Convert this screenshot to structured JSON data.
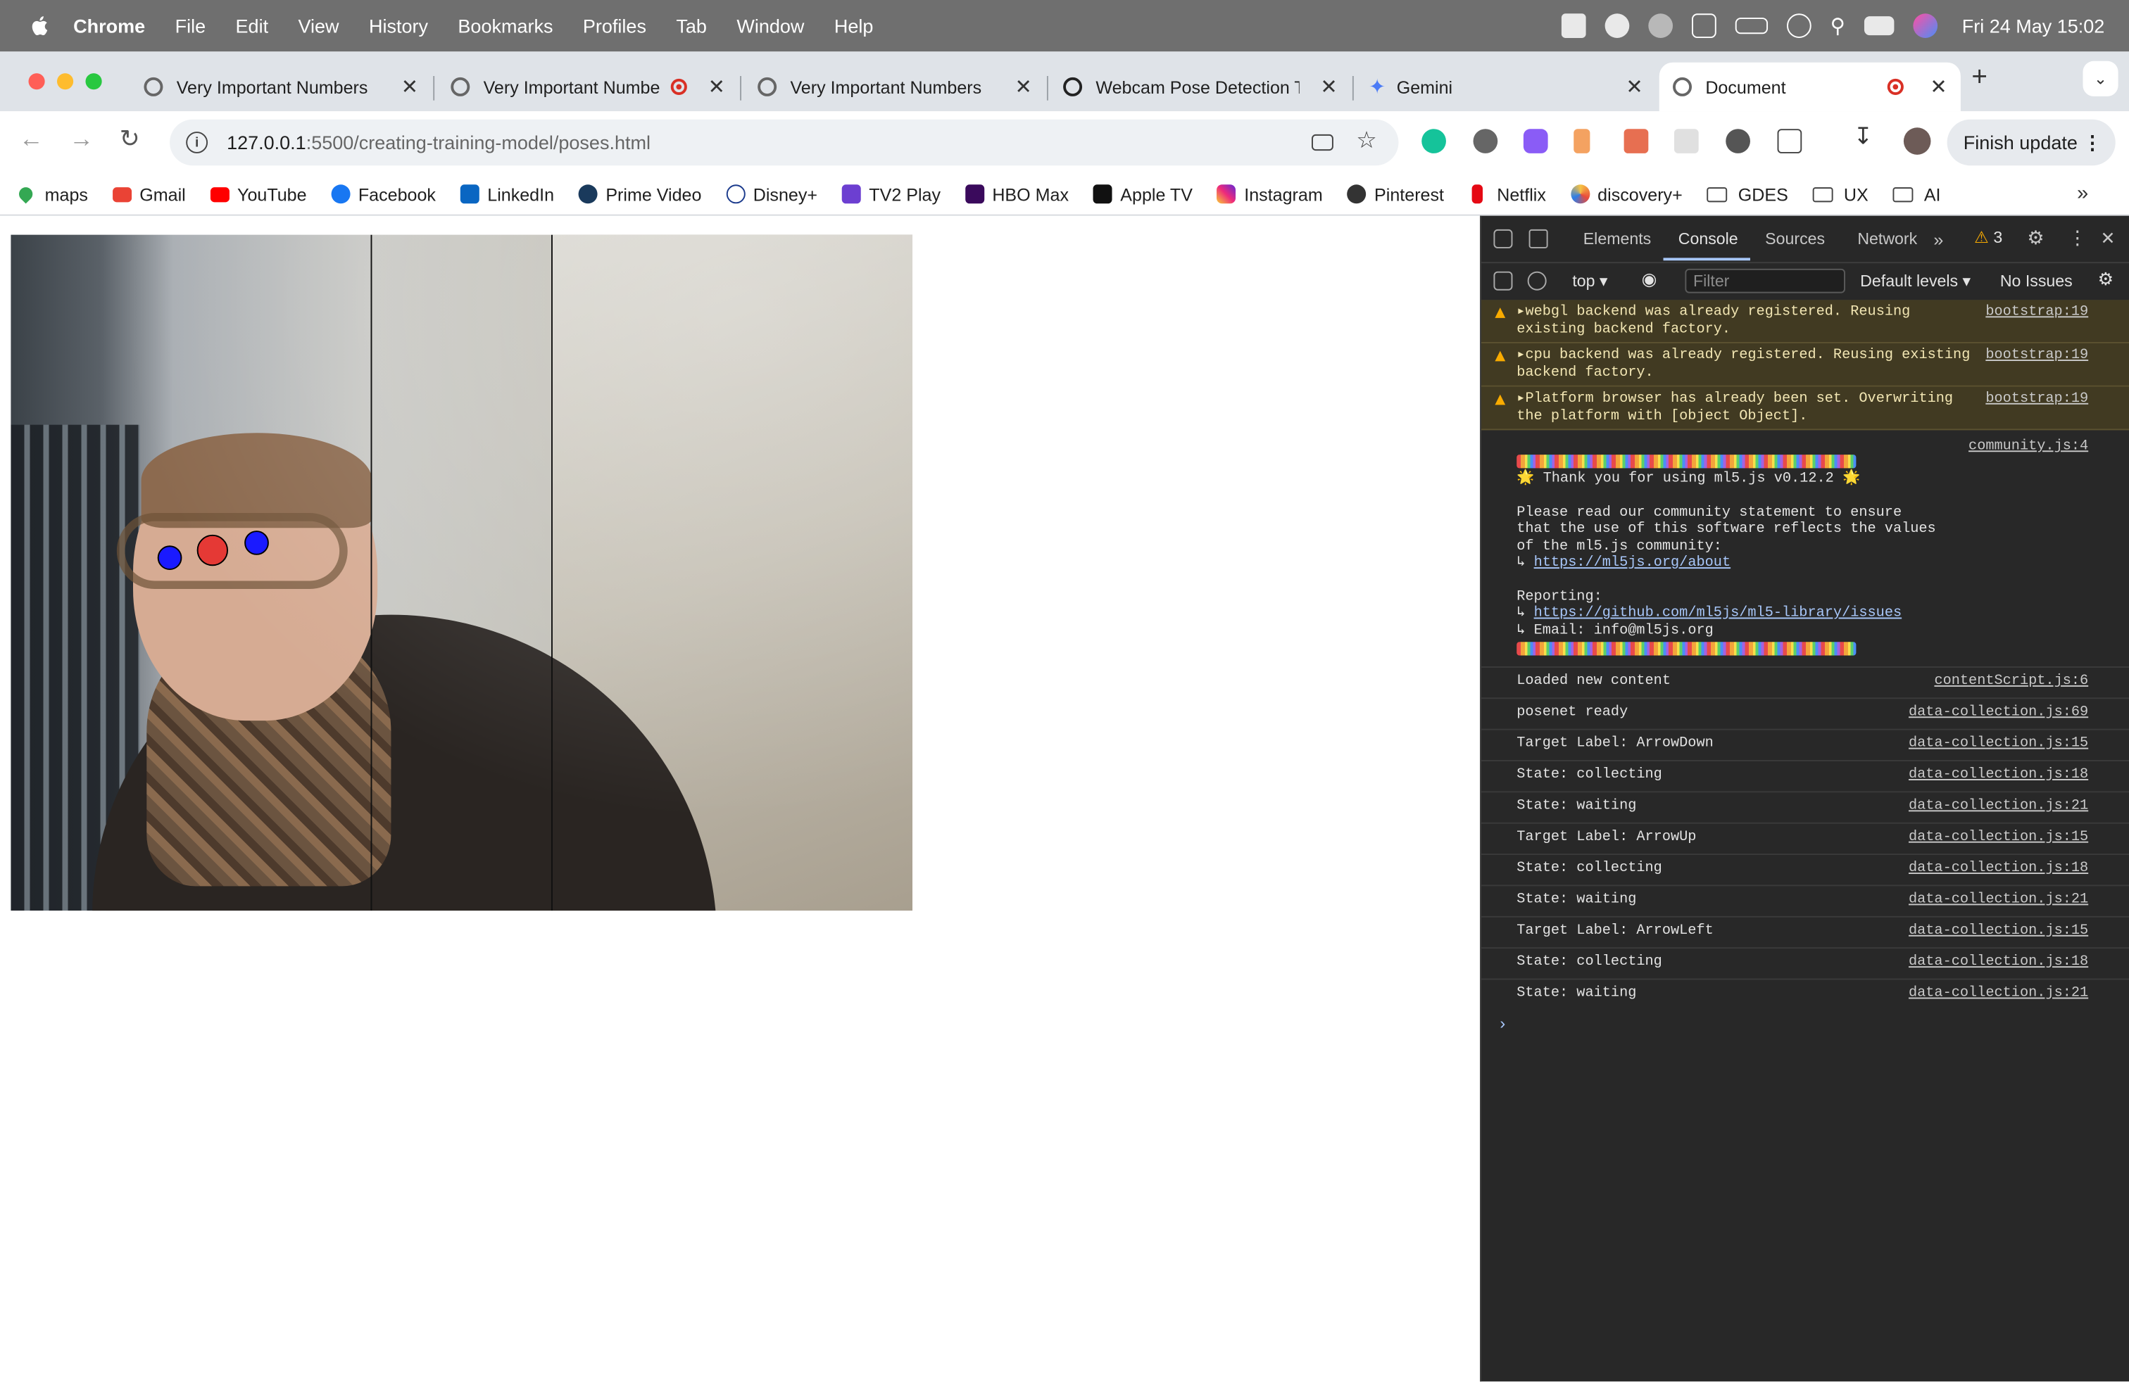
{
  "menubar": {
    "app": "Chrome",
    "items": [
      "File",
      "Edit",
      "View",
      "History",
      "Bookmarks",
      "Profiles",
      "Tab",
      "Window",
      "Help"
    ],
    "clock": "Fri 24 May  15:02"
  },
  "tabs": [
    {
      "title": "Very Important Numbers",
      "recording": false
    },
    {
      "title": "Very Important Numbe",
      "recording": true
    },
    {
      "title": "Very Important Numbers",
      "recording": false
    },
    {
      "title": "Webcam Pose Detection T",
      "recording": false
    },
    {
      "title": "Gemini",
      "recording": false
    },
    {
      "title": "Document",
      "recording": true,
      "active": true
    }
  ],
  "toolbar": {
    "url_host": "127.0.0.1",
    "url_path": ":5500/creating-training-model/poses.html",
    "finish_update": "Finish update"
  },
  "bookmarks": [
    "maps",
    "Gmail",
    "YouTube",
    "Facebook",
    "LinkedIn",
    "Prime Video",
    "Disney+",
    "TV2 Play",
    "HBO Max",
    "Apple TV",
    "Instagram",
    "Pinterest",
    "Netflix",
    "discovery+",
    "GDES",
    "UX",
    "AI"
  ],
  "devtools": {
    "tabs": [
      "Elements",
      "Console",
      "Sources",
      "Network"
    ],
    "warning_count": "3",
    "context": "top",
    "filter_placeholder": "Filter",
    "levels": "Default levels",
    "issues": "No Issues"
  },
  "console": {
    "warnings": [
      {
        "text": "webgl backend was already registered. Reusing existing backend factory.",
        "source": "bootstrap:19"
      },
      {
        "text": "cpu backend was already registered. Reusing existing backend factory.",
        "source": "bootstrap:19"
      },
      {
        "text": "Platform browser has already been set. Overwriting the platform with [object Object].",
        "source": "bootstrap:19"
      }
    ],
    "community": {
      "source": "community.js:4",
      "thanks": "🌟 Thank you for using ml5.js v0.12.2 🌟",
      "statement": "Please read our community statement to ensure\nthat the use of this software reflects the values\nof the ml5.js community:",
      "about_link": "https://ml5js.org/about",
      "reporting": "Reporting:",
      "issues_link": "https://github.com/ml5js/ml5-library/issues",
      "email": "↳ Email: info@ml5js.org"
    },
    "logs": [
      {
        "text": "Loaded new content",
        "source": "contentScript.js:6"
      },
      {
        "text": "posenet ready",
        "source": "data-collection.js:69"
      },
      {
        "text": "Target Label: ArrowDown",
        "source": "data-collection.js:15"
      },
      {
        "text": "State: collecting",
        "source": "data-collection.js:18"
      },
      {
        "text": "State: waiting",
        "source": "data-collection.js:21"
      },
      {
        "text": "Target Label: ArrowUp",
        "source": "data-collection.js:15"
      },
      {
        "text": "State: collecting",
        "source": "data-collection.js:18"
      },
      {
        "text": "State: waiting",
        "source": "data-collection.js:21"
      },
      {
        "text": "Target Label: ArrowLeft",
        "source": "data-collection.js:15"
      },
      {
        "text": "State: collecting",
        "source": "data-collection.js:18"
      },
      {
        "text": "State: waiting",
        "source": "data-collection.js:21"
      }
    ]
  },
  "colors": {
    "keypoint_nose": "#e53935",
    "keypoint_eyes": "#1a1aff",
    "devtools_bg": "#282828",
    "warning_bg": "#413a22"
  }
}
